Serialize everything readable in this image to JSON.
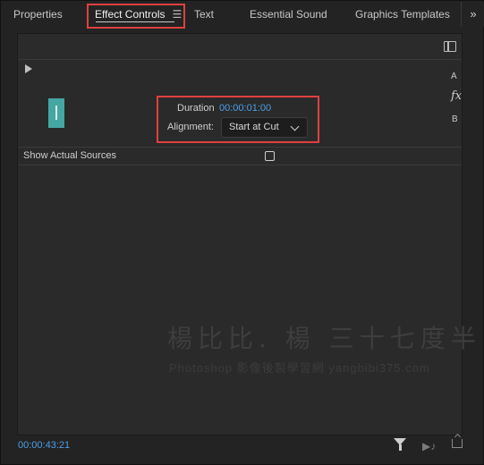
{
  "tabs": [
    {
      "label": "Properties",
      "active": false
    },
    {
      "label": "Effect Controls",
      "active": true,
      "menu_icon": "hamburger-menu-icon"
    },
    {
      "label": "Text",
      "active": false
    },
    {
      "label": "Essential Sound",
      "active": false
    },
    {
      "label": "Graphics Templates",
      "active": false
    }
  ],
  "overflow": {
    "label": "»",
    "icon": "double-chevron-right-icon"
  },
  "effect": {
    "duration_label": "Duration",
    "duration_value": "00:00:01:00",
    "alignment_label": "Alignment:",
    "alignment_value": "Start at Cut",
    "side_a": "A",
    "side_fx": "fx",
    "side_b": "B"
  },
  "show_actual_sources": {
    "label": "Show Actual Sources",
    "checked": false
  },
  "watermark": {
    "line1": "楊比比. 楊 三十七度半",
    "line2": "Photoshop 影像後製學習網 yangbibi375.com"
  },
  "footer": {
    "timecode": "00:00:43:21"
  },
  "colors": {
    "accent_blue": "#4d9fe8",
    "highlight_red": "#e0403f",
    "thumb_teal": "#45a7a4"
  }
}
